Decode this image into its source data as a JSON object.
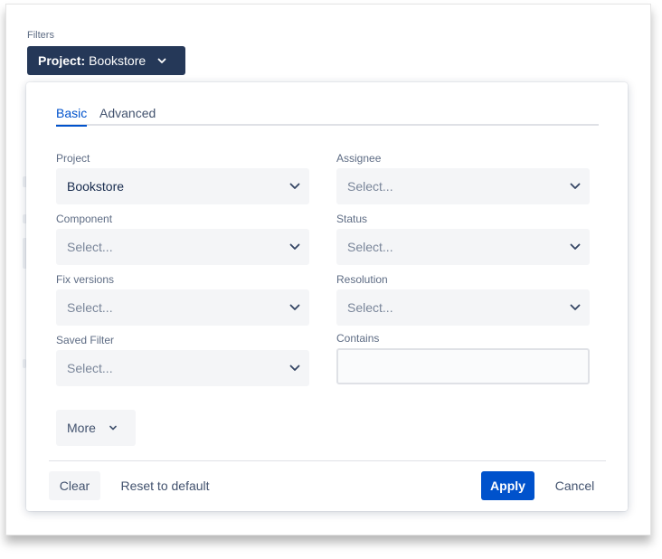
{
  "header": {
    "filters_label": "Filters",
    "project_button": {
      "prefix": "Project:",
      "value": "Bookstore"
    }
  },
  "tabs": [
    {
      "label": "Basic",
      "active": true
    },
    {
      "label": "Advanced",
      "active": false
    }
  ],
  "fields": {
    "project": {
      "label": "Project",
      "value": "Bookstore"
    },
    "assignee": {
      "label": "Assignee",
      "placeholder": "Select..."
    },
    "component": {
      "label": "Component",
      "placeholder": "Select..."
    },
    "status": {
      "label": "Status",
      "placeholder": "Select..."
    },
    "fix_versions": {
      "label": "Fix versions",
      "placeholder": "Select..."
    },
    "resolution": {
      "label": "Resolution",
      "placeholder": "Select..."
    },
    "saved_filter": {
      "label": "Saved Filter",
      "placeholder": "Select..."
    },
    "contains": {
      "label": "Contains",
      "value": ""
    }
  },
  "more_label": "More",
  "footer": {
    "clear_label": "Clear",
    "reset_label": "Reset to default",
    "apply_label": "Apply",
    "cancel_label": "Cancel"
  },
  "colors": {
    "primary": "#0052cc",
    "project_button_bg": "#253858",
    "field_bg": "#f4f5f7"
  }
}
